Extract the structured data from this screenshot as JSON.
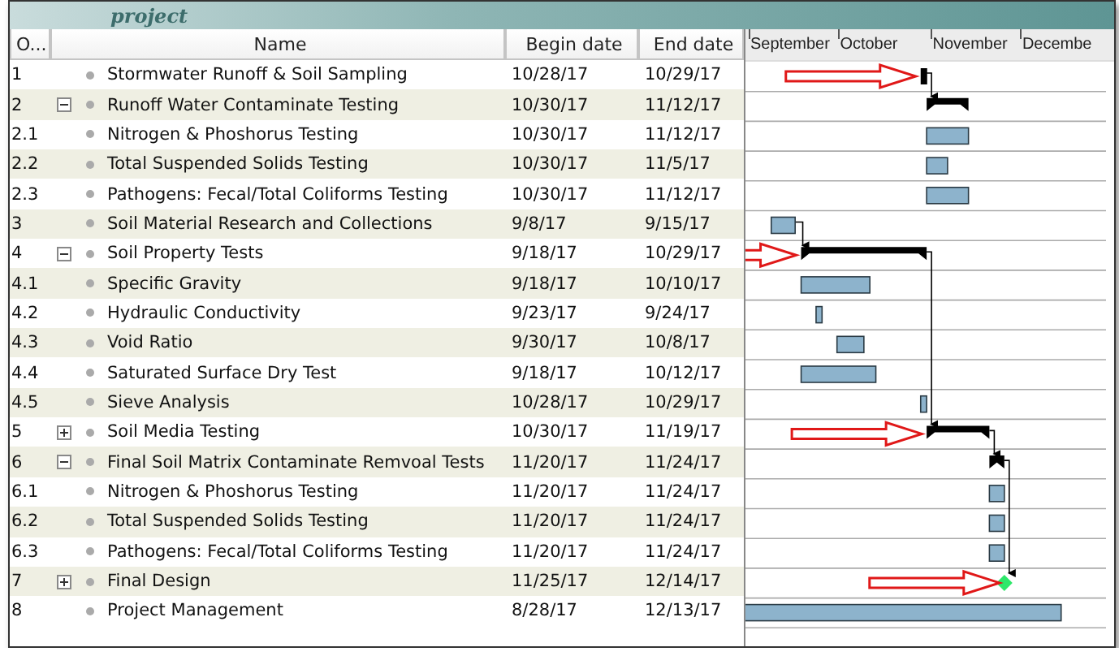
{
  "banner": {
    "text": "project"
  },
  "table": {
    "columns": [
      "O...",
      "Name",
      "Begin date",
      "End date"
    ],
    "rows": [
      {
        "number": "1",
        "name": "Stormwater Runoff & Soil Sampling",
        "begin": "10/28/17",
        "end": "10/29/17",
        "kind": "critical",
        "flagged": true
      },
      {
        "number": "2",
        "name": "Runoff Water Contaminate Testing",
        "begin": "10/30/17",
        "end": "11/12/17",
        "kind": "summary",
        "flagged": false,
        "expanded": true,
        "children": [
          {
            "number": "2.1",
            "name": "Nitrogen & Phoshorus Testing",
            "begin": "10/30/17",
            "end": "11/12/17",
            "kind": "task",
            "flagged": false
          },
          {
            "number": "2.2",
            "name": "Total Suspended Solids Testing",
            "begin": "10/30/17",
            "end": "11/5/17",
            "kind": "task",
            "flagged": false
          },
          {
            "number": "2.3",
            "name": "Pathogens: Fecal/Total Coliforms Testing",
            "begin": "10/30/17",
            "end": "11/12/17",
            "kind": "task",
            "flagged": false
          }
        ]
      },
      {
        "number": "3",
        "name": "Soil Material Research and Collections",
        "begin": "9/8/17",
        "end": "9/15/17",
        "kind": "task",
        "flagged": false
      },
      {
        "number": "4",
        "name": "Soil Property Tests",
        "begin": "9/18/17",
        "end": "10/29/17",
        "kind": "summary",
        "flagged": true,
        "expanded": true,
        "children": [
          {
            "number": "4.1",
            "name": "Specific Gravity",
            "begin": "9/18/17",
            "end": "10/10/17",
            "kind": "task",
            "flagged": false
          },
          {
            "number": "4.2",
            "name": "Hydraulic Conductivity",
            "begin": "9/23/17",
            "end": "9/24/17",
            "kind": "task",
            "flagged": false
          },
          {
            "number": "4.3",
            "name": "Void Ratio",
            "begin": "9/30/17",
            "end": "10/8/17",
            "kind": "task",
            "flagged": false
          },
          {
            "number": "4.4",
            "name": "Saturated Surface Dry Test",
            "begin": "9/18/17",
            "end": "10/12/17",
            "kind": "task",
            "flagged": false
          },
          {
            "number": "4.5",
            "name": "Sieve Analysis",
            "begin": "10/28/17",
            "end": "10/29/17",
            "kind": "task",
            "flagged": false
          }
        ]
      },
      {
        "number": "5",
        "name": "Soil Media Testing",
        "begin": "10/30/17",
        "end": "11/19/17",
        "kind": "summary",
        "flagged": true,
        "expanded": false
      },
      {
        "number": "6",
        "name": "Final Soil Matrix Contaminate Remvoal Tests",
        "begin": "11/20/17",
        "end": "11/24/17",
        "kind": "summary",
        "flagged": false,
        "expanded": true,
        "children": [
          {
            "number": "6.1",
            "name": "Nitrogen & Phoshorus Testing",
            "begin": "11/20/17",
            "end": "11/24/17",
            "kind": "task",
            "flagged": false
          },
          {
            "number": "6.2",
            "name": "Total Suspended Solids Testing",
            "begin": "11/20/17",
            "end": "11/24/17",
            "kind": "task",
            "flagged": false
          },
          {
            "number": "6.3",
            "name": "Pathogens: Fecal/Total Coliforms Testing",
            "begin": "11/20/17",
            "end": "11/24/17",
            "kind": "task",
            "flagged": false
          }
        ]
      },
      {
        "number": "7",
        "name": "Final Design",
        "begin": "11/25/17",
        "end": "12/14/17",
        "kind": "milestone",
        "flagged": true,
        "expanded": false
      },
      {
        "number": "8",
        "name": "Project Management",
        "begin": "8/28/17",
        "end": "12/13/17",
        "kind": "task",
        "flagged": false
      }
    ]
  },
  "gantt": {
    "months": [
      "September",
      "October",
      "November",
      "Decembe"
    ]
  }
}
